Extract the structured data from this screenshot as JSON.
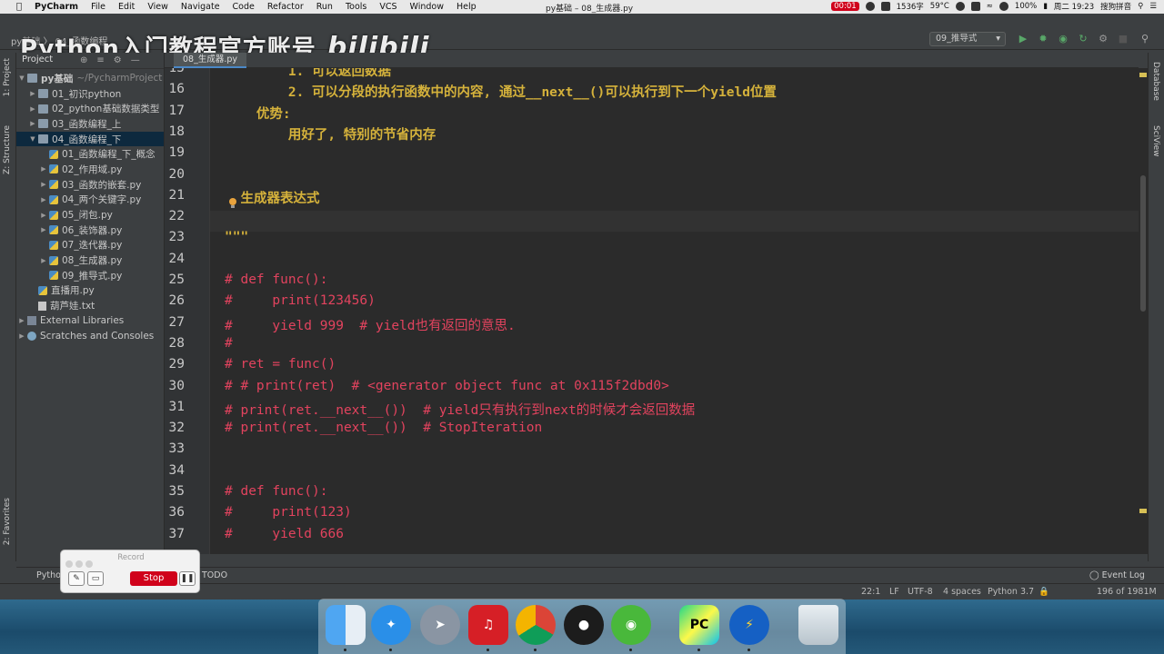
{
  "menubar": {
    "app_name": "PyCharm",
    "items": [
      "File",
      "Edit",
      "View",
      "Navigate",
      "Code",
      "Refactor",
      "Run",
      "Tools",
      "VCS",
      "Window",
      "Help"
    ],
    "window_title": "py基础 – 08_生成器.py",
    "status": {
      "record_time": "00:01",
      "char_count": "1536字",
      "temp": "59°C",
      "battery": "100%",
      "datetime": "周二 19:23",
      "input_method": "搜狗拼音"
    }
  },
  "watermark": {
    "text": "Python入门教程官方账号",
    "brand": "bilibili"
  },
  "breadcrumbs": "py基础 〉 04_函数编程",
  "run_config": "09_推导式",
  "project_panel": {
    "header": "Project",
    "root": "py基础",
    "root_path": "~/PycharmProject",
    "items": [
      {
        "label": "01_初识python",
        "type": "folder",
        "depth": 1
      },
      {
        "label": "02_python基础数据类型",
        "type": "folder",
        "depth": 1
      },
      {
        "label": "03_函数编程_上",
        "type": "folder",
        "depth": 1
      },
      {
        "label": "04_函数编程_下",
        "type": "folder",
        "depth": 1
      },
      {
        "label": "01_函数编程_下_概念",
        "type": "py",
        "depth": 2
      },
      {
        "label": "02_作用域.py",
        "type": "py",
        "depth": 2
      },
      {
        "label": "03_函数的嵌套.py",
        "type": "py",
        "depth": 2
      },
      {
        "label": "04_两个关键字.py",
        "type": "py",
        "depth": 2
      },
      {
        "label": "05_闭包.py",
        "type": "py",
        "depth": 2
      },
      {
        "label": "06_装饰器.py",
        "type": "py",
        "depth": 2
      },
      {
        "label": "07_迭代器.py",
        "type": "py",
        "depth": 2
      },
      {
        "label": "08_生成器.py",
        "type": "py",
        "depth": 2
      },
      {
        "label": "09_推导式.py",
        "type": "py",
        "depth": 2
      },
      {
        "label": "直播用.py",
        "type": "py",
        "depth": 1
      },
      {
        "label": "葫芦娃.txt",
        "type": "txt",
        "depth": 1
      },
      {
        "label": "External Libraries",
        "type": "lib",
        "depth": 0
      },
      {
        "label": "Scratches and Consoles",
        "type": "scratch",
        "depth": 0
      }
    ]
  },
  "side_tabs": {
    "project": "1: Project",
    "structure": "Z: Structure",
    "favorites": "2: Favorites",
    "database": "Database",
    "sciview": "SciView"
  },
  "editor": {
    "tab": "08_生成器.py",
    "lines": [
      {
        "n": "15",
        "text": "        1. 可以返回数据",
        "style": "doc"
      },
      {
        "n": "16",
        "text": "        2. 可以分段的执行函数中的内容, 通过__next__()可以执行到下一个yield位置",
        "style": "doc"
      },
      {
        "n": "17",
        "text": "    优势:",
        "style": "doc"
      },
      {
        "n": "18",
        "text": "        用好了, 特别的节省内存",
        "style": "doc"
      },
      {
        "n": "19",
        "text": "",
        "style": "doc"
      },
      {
        "n": "20",
        "text": "",
        "style": "doc"
      },
      {
        "n": "21",
        "text": "  生成器表达式",
        "style": "doc"
      },
      {
        "n": "22",
        "text": "",
        "style": "doc"
      },
      {
        "n": "23",
        "text": "\"\"\"",
        "style": "doc"
      },
      {
        "n": "24",
        "text": "",
        "style": "cmt"
      },
      {
        "n": "25",
        "text": "# def func():",
        "style": "cmt"
      },
      {
        "n": "26",
        "text": "#     print(123456)",
        "style": "cmt"
      },
      {
        "n": "27",
        "text": "#     yield 999  # yield也有返回的意思.",
        "style": "cmt"
      },
      {
        "n": "28",
        "text": "#",
        "style": "cmt"
      },
      {
        "n": "29",
        "text": "# ret = func()",
        "style": "cmt"
      },
      {
        "n": "30",
        "text": "# # print(ret)  # <generator object func at 0x115f2dbd0>",
        "style": "cmt"
      },
      {
        "n": "31",
        "text": "# print(ret.__next__())  # yield只有执行到next的时候才会返回数据",
        "style": "cmt"
      },
      {
        "n": "32",
        "text": "# print(ret.__next__())  # StopIteration",
        "style": "cmt"
      },
      {
        "n": "33",
        "text": "",
        "style": "cmt"
      },
      {
        "n": "34",
        "text": "",
        "style": "cmt"
      },
      {
        "n": "35",
        "text": "# def func():",
        "style": "cmt"
      },
      {
        "n": "36",
        "text": "#     print(123)",
        "style": "cmt"
      },
      {
        "n": "37",
        "text": "#     yield 666",
        "style": "cmt"
      }
    ]
  },
  "bottom_tools": {
    "python_console": "Pytho",
    "todo": "TODO",
    "event_log": "Event Log"
  },
  "statusbar": {
    "position": "22:1",
    "line_sep": "LF",
    "encoding": "UTF-8",
    "indent": "4 spaces",
    "interpreter": "Python 3.7",
    "memory": "196 of 1981M"
  },
  "record_widget": {
    "title": "Record",
    "stop_label": "Stop"
  },
  "dock": {
    "apps": [
      "finder",
      "safari",
      "launchpad",
      "netease-music",
      "chrome",
      "qq",
      "wechat",
      "pycharm",
      "thunder",
      "trash"
    ]
  },
  "colors": {
    "editor_bg": "#2b2b2b",
    "docstring": "#d5b23b",
    "comment": "#e2435e",
    "selection": "#0d293e"
  }
}
